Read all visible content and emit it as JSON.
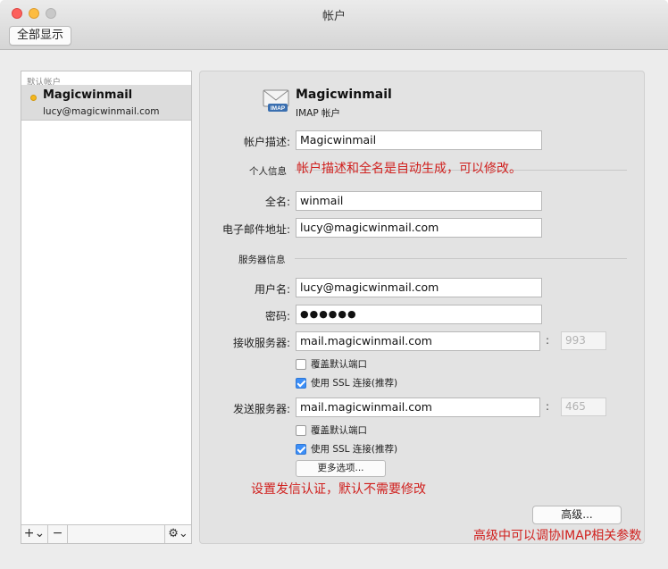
{
  "window": {
    "title": "帐户",
    "show_all_button": "全部显示"
  },
  "sidebar": {
    "section_header": "默认帐户",
    "account": {
      "name": "Magicwinmail",
      "email": "lucy@magicwinmail.com"
    },
    "toolbar": {
      "add": "+⌄",
      "remove": "−",
      "gear": "⚙⌄"
    }
  },
  "detail": {
    "account_name": "Magicwinmail",
    "account_type": "IMAP 帐户",
    "description_label": "帐户描述:",
    "description_value": "Magicwinmail",
    "personal_section": "个人信息",
    "full_name_label": "全名:",
    "full_name_value": "winmail",
    "email_label": "电子邮件地址:",
    "email_value": "lucy@magicwinmail.com",
    "server_section": "服务器信息",
    "username_label": "用户名:",
    "username_value": "lucy@magicwinmail.com",
    "password_label": "密码:",
    "password_value": "●●●●●●",
    "incoming_label": "接收服务器:",
    "incoming_value": "mail.magicwinmail.com",
    "incoming_port": "993",
    "incoming_override_port": "覆盖默认端口",
    "incoming_ssl": "使用 SSL 连接(推荐)",
    "outgoing_label": "发送服务器:",
    "outgoing_value": "mail.magicwinmail.com",
    "outgoing_port": "465",
    "outgoing_override_port": "覆盖默认端口",
    "outgoing_ssl": "使用 SSL 连接(推荐)",
    "more_options_button": "更多选项...",
    "advanced_button": "高级...",
    "colon": ":"
  },
  "checkboxes": {
    "incoming_override_checked": false,
    "incoming_ssl_checked": true,
    "outgoing_override_checked": false,
    "outgoing_ssl_checked": true
  },
  "annotations": {
    "auto_generated": "帐户描述和全名是自动生成，可以修改。",
    "auth_settings": "设置发信认证，默认不需要修改",
    "advanced_imap": "高级中可以调协IMAP相关参数"
  },
  "colors": {
    "annotation": "#d0201e",
    "checkbox_on": "#3c8ef7",
    "account_dot": "#f5b71d"
  }
}
